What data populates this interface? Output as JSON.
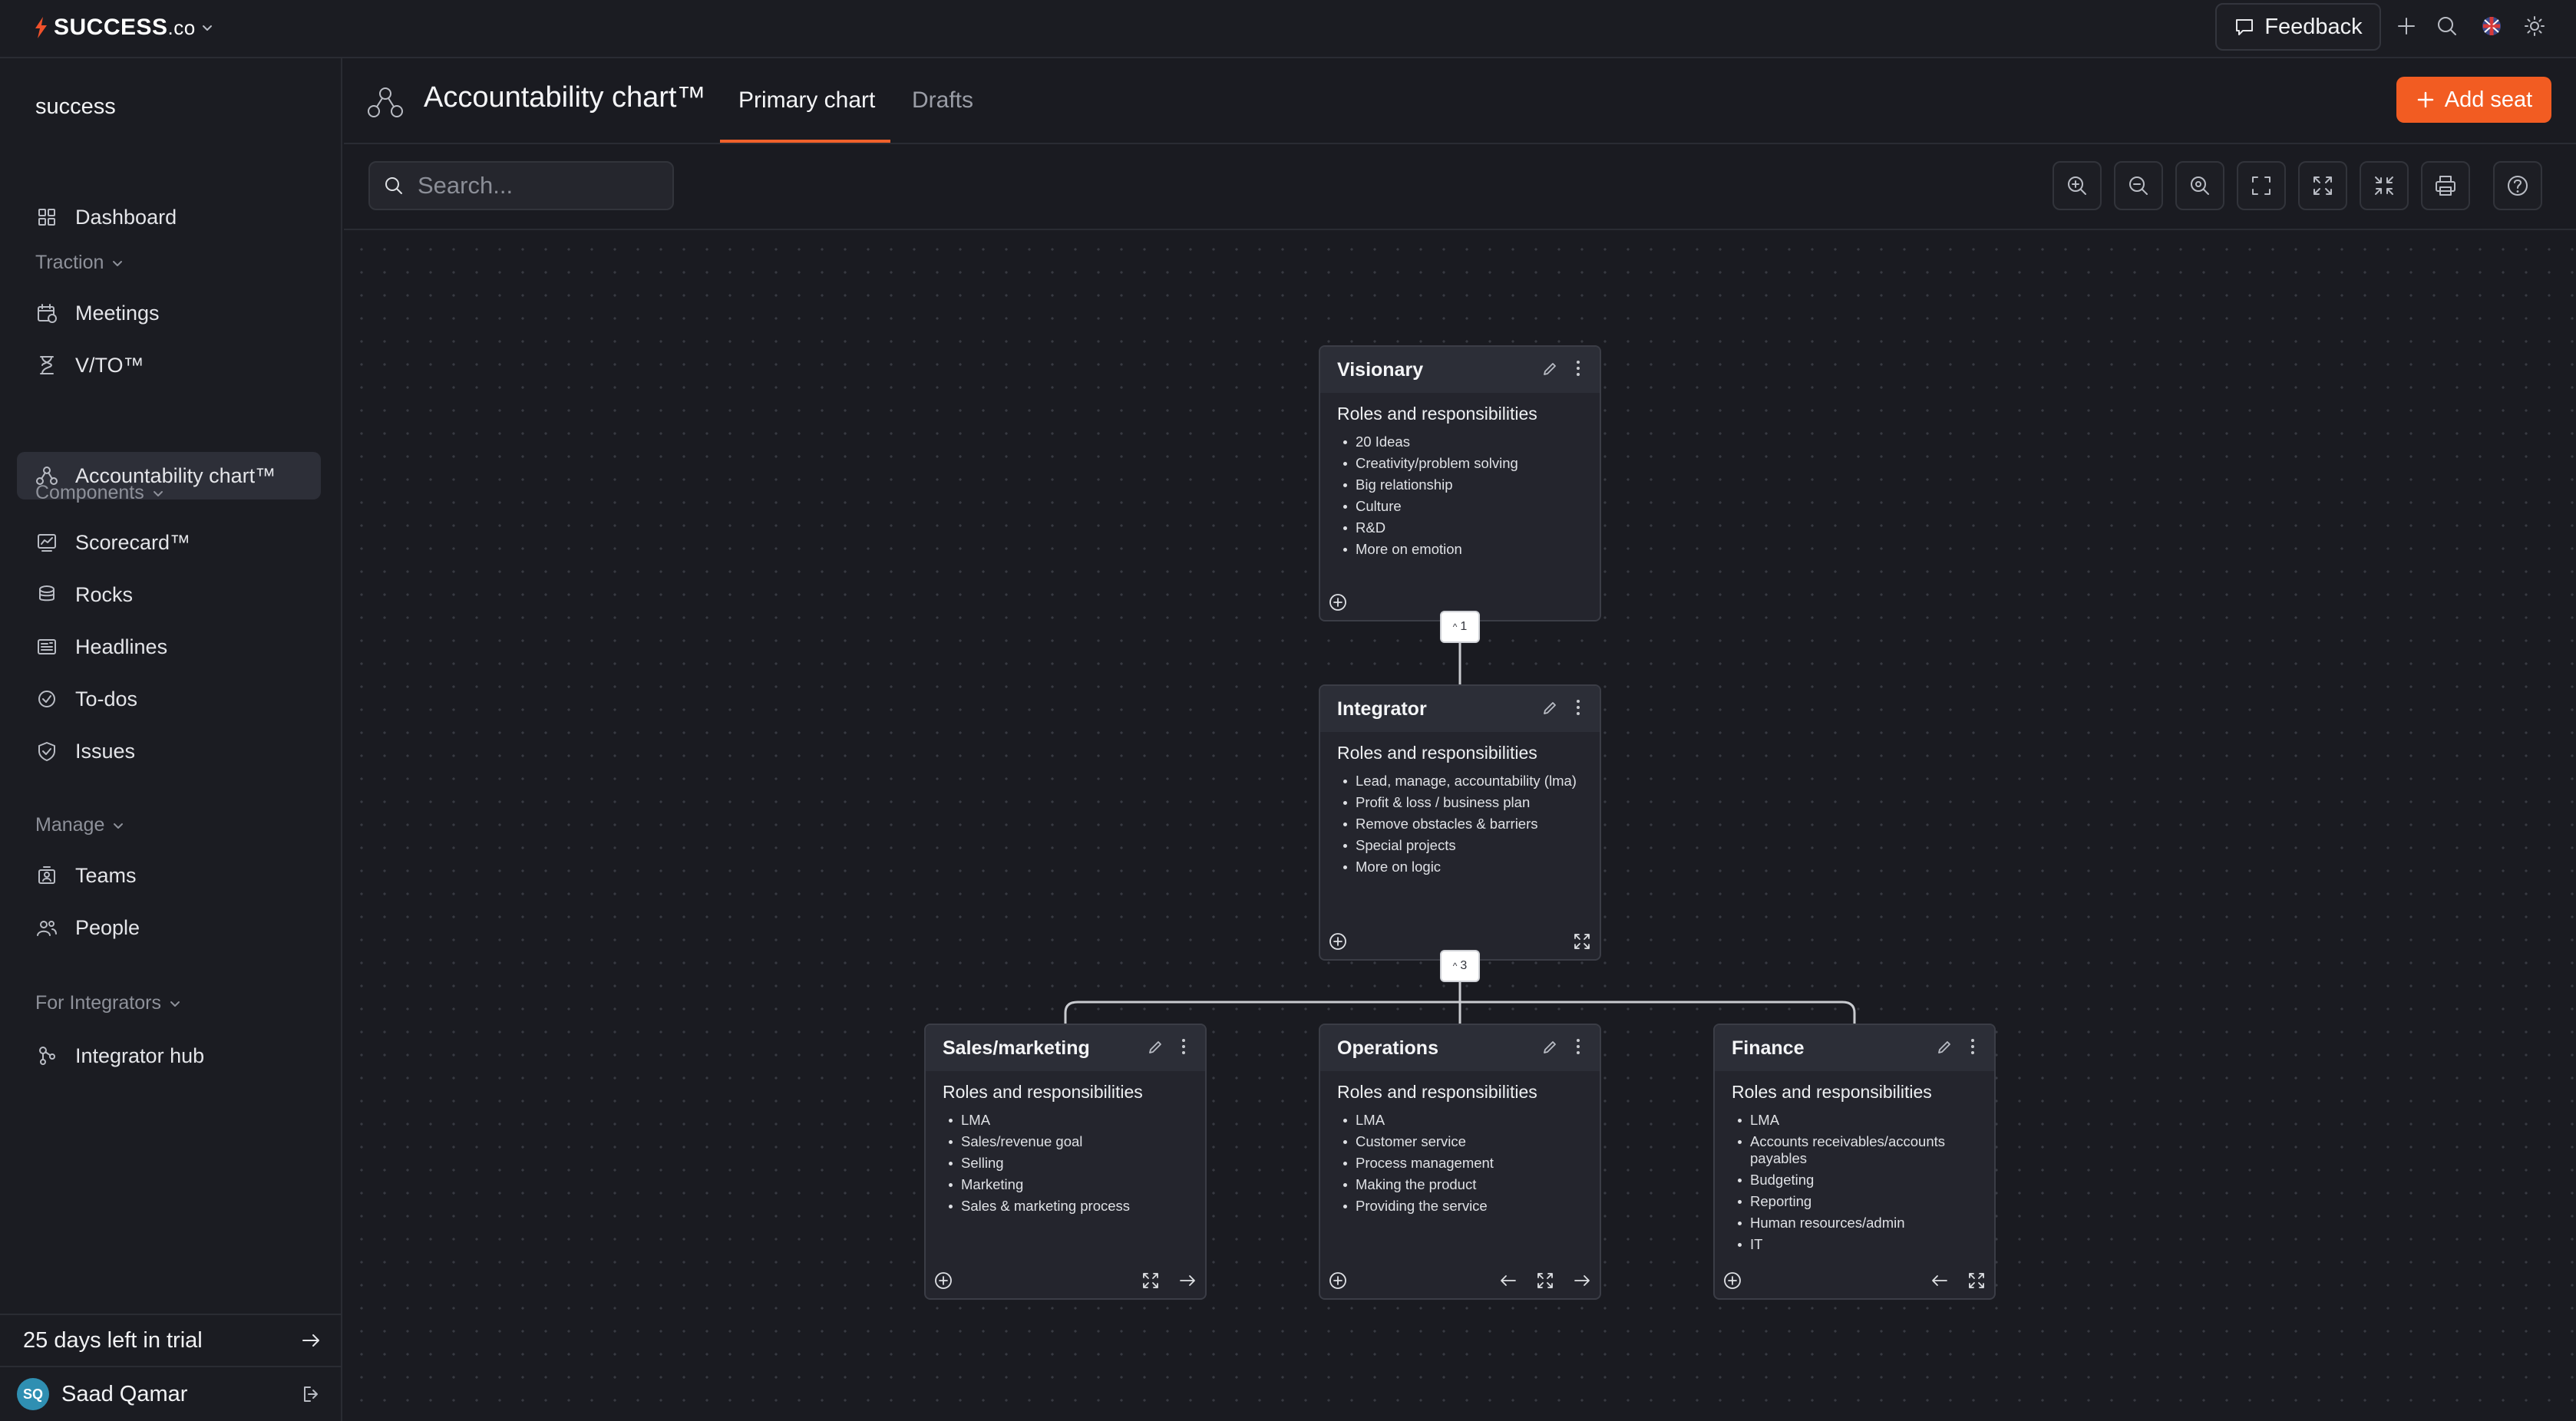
{
  "app": {
    "brand": "SUCCESS",
    "brand_suffix": ".co"
  },
  "topbar": {
    "feedback_label": "Feedback"
  },
  "sidebar": {
    "workspace": "success",
    "dashboard": "Dashboard",
    "sections": {
      "traction": "Traction",
      "components": "Components",
      "manage": "Manage",
      "integrators": "For Integrators"
    },
    "items": {
      "meetings": "Meetings",
      "vto": "V/TO™",
      "accountability": "Accountability chart™",
      "scorecard": "Scorecard™",
      "rocks": "Rocks",
      "headlines": "Headlines",
      "todos": "To-dos",
      "issues": "Issues",
      "teams": "Teams",
      "people": "People",
      "integrator_hub": "Integrator hub"
    },
    "trial": "25 days left in trial",
    "user": {
      "initials": "SQ",
      "name": "Saad Qamar"
    }
  },
  "header": {
    "title": "Accountability chart™",
    "tabs": [
      "Primary chart",
      "Drafts"
    ],
    "active_tab": "Primary chart",
    "add_seat": "Add seat"
  },
  "toolbar": {
    "search_placeholder": "Search..."
  },
  "chart": {
    "seats": [
      {
        "title": "Visionary",
        "subtitle": "Roles and responsibilities",
        "roles": [
          "20 Ideas",
          "Creativity/problem solving",
          "Big relationship",
          "Culture",
          "R&D",
          "More on emotion"
        ],
        "children_count": "1"
      },
      {
        "title": "Integrator",
        "subtitle": "Roles and responsibilities",
        "roles": [
          "Lead, manage, accountability (lma)",
          "Profit & loss / business plan",
          "Remove obstacles & barriers",
          "Special projects",
          "More on logic"
        ],
        "children_count": "3"
      },
      {
        "title": "Sales/marketing",
        "subtitle": "Roles and responsibilities",
        "roles": [
          "LMA",
          "Sales/revenue goal",
          "Selling",
          "Marketing",
          "Sales & marketing process"
        ]
      },
      {
        "title": "Operations",
        "subtitle": "Roles and responsibilities",
        "roles": [
          "LMA",
          "Customer service",
          "Process management",
          "Making the product",
          "Providing the service"
        ]
      },
      {
        "title": "Finance",
        "subtitle": "Roles and responsibilities",
        "roles": [
          "LMA",
          "Accounts receivables/accounts payables",
          "Budgeting",
          "Reporting",
          "Human resources/admin",
          "IT"
        ]
      }
    ]
  },
  "colors": {
    "accent": "#f25c22",
    "background": "#1a1b21",
    "card": "#24252d",
    "avatar": "#2f8fb2"
  }
}
